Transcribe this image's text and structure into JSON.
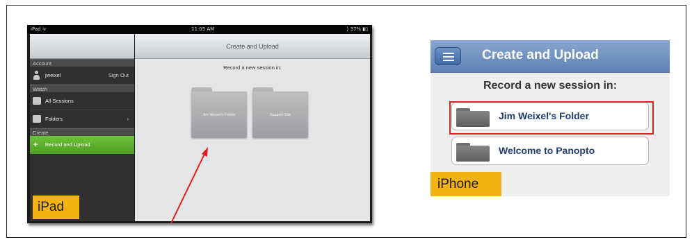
{
  "ipad": {
    "status": {
      "carrier": "iPad ᯤ",
      "time": "11:05 AM",
      "battery": "⟩ 37% ▮▯"
    },
    "sidebar": {
      "account_header": "Account",
      "user": "jweixel",
      "sign_out": "Sign Out",
      "watch_header": "Watch",
      "all_sessions": "All Sessions",
      "folders": "Folders",
      "folders_chevron": "›",
      "create_header": "Create",
      "record_upload": "Record and Upload"
    },
    "main": {
      "title": "Create and Upload",
      "record_label": "Record a new session in:",
      "folders": [
        "Jim Weixel's Folder",
        "Support Site"
      ]
    },
    "badge": "iPad"
  },
  "iphone": {
    "title": "Create and Upload",
    "record_label": "Record a new session in:",
    "folders": [
      "Jim Weixel's Folder",
      "Welcome to Panopto"
    ],
    "badge": "iPhone"
  },
  "colors": {
    "badge": "#f3b313",
    "highlight": "#e02020",
    "arrow": "#e02020",
    "active_green": "#5aab2b",
    "iphone_nav": "#6f90c0"
  }
}
